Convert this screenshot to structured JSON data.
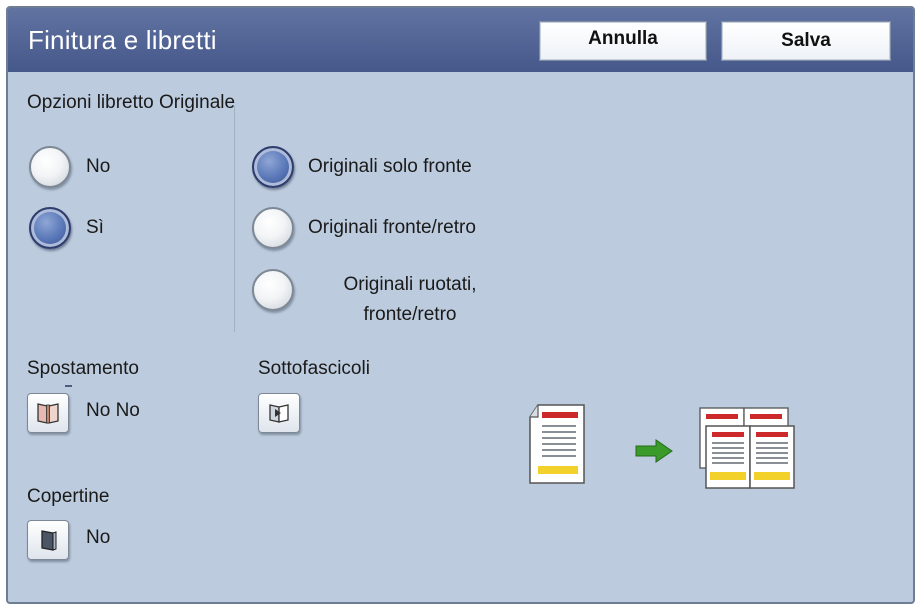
{
  "header": {
    "title": "Finitura e libretti",
    "cancel_label": "Annulla",
    "save_label": "Salva"
  },
  "booklet": {
    "section_label": "Opzioni libretto Originale",
    "options": [
      {
        "label": "No",
        "selected": false
      },
      {
        "label": "Sì",
        "selected": true
      }
    ],
    "original_types": [
      {
        "label": "Originali solo fronte",
        "selected": true
      },
      {
        "label": "Originali fronte/retro",
        "selected": false
      },
      {
        "label_line1": "Originali ruotati,",
        "label_line2": "fronte/retro",
        "selected": false
      }
    ]
  },
  "shift": {
    "label": "Spostamento",
    "value": "No No"
  },
  "subsets": {
    "label": "Sottofascicoli"
  },
  "covers": {
    "label": "Copertine",
    "value": "No"
  },
  "colors": {
    "panel_bg": "#bccbdd",
    "header_bg": "#45588a",
    "radio_selected": "#5a78b8",
    "arrow_green": "#3a9a2a",
    "doc_red": "#cc2a2a",
    "doc_yellow": "#f2d22a"
  },
  "icons": {
    "shift": "booklet-shift-icon",
    "subsets": "subset-icon",
    "covers": "cover-icon",
    "preview_source": "single-page-document-icon",
    "preview_arrow": "right-arrow-icon",
    "preview_result": "booklet-output-icon"
  }
}
